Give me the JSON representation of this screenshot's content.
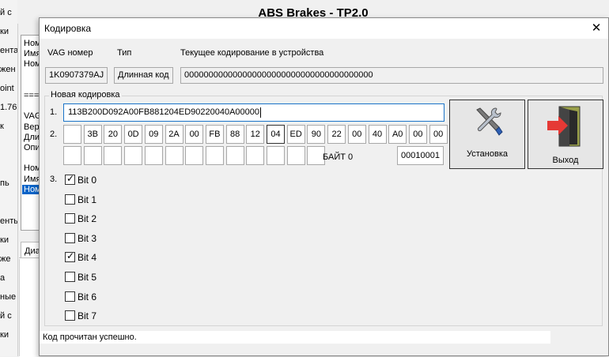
{
  "background_app": {
    "window_title": "ABS Brakes -  TP2.0",
    "left_labels": [
      "й с",
      "ки",
      "ента",
      "жен",
      "oint",
      "1.76",
      "к",
      "",
      "",
      "пь",
      "",
      "енты",
      "ки",
      "же",
      "а",
      "ные",
      "й с",
      "ки"
    ],
    "list_items": [
      "Ном",
      "Имя",
      "Ном",
      "",
      "",
      "===",
      "",
      "VAG",
      "Вер",
      "Дли",
      "Опи",
      "",
      "Ном",
      "Имя",
      "Ном"
    ],
    "tab_label": "Диа"
  },
  "dialog": {
    "title": "Кодировка",
    "close_label": "✕",
    "vag_label": "VAG номер",
    "vag_value": "1K0907379AJ",
    "type_label": "Тип",
    "type_value": "Длинная код",
    "current_label": "Текущее кодирование в устройства",
    "current_value": "000000000000000000000000000000000000000",
    "new_group_title": "Новая кодировка",
    "step1": "1.",
    "step2": "2.",
    "step3": "3.",
    "new_coding_value": "113B200D092A00FB881204ED90220040A00000",
    "bytes": [
      "",
      "3B",
      "20",
      "0D",
      "09",
      "2A",
      "00",
      "FB",
      "88",
      "12",
      "04",
      "ED",
      "90",
      "22",
      "00",
      "40",
      "A0",
      "00",
      "00"
    ],
    "bytes_row2": [
      "",
      "",
      "",
      "",
      "",
      "",
      "",
      "",
      "",
      "",
      "",
      "",
      ""
    ],
    "active_byte_index": 10,
    "byte_label": "БАЙТ 0",
    "byte_binary": "00010001",
    "install_button": "Установка",
    "exit_button": "Выход",
    "bits": [
      {
        "label": "Bit 0",
        "checked": true
      },
      {
        "label": "Bit 1",
        "checked": false
      },
      {
        "label": "Bit 2",
        "checked": false
      },
      {
        "label": "Bit 3",
        "checked": false
      },
      {
        "label": "Bit 4",
        "checked": true
      },
      {
        "label": "Bit 5",
        "checked": false
      },
      {
        "label": "Bit 6",
        "checked": false
      },
      {
        "label": "Bit 7",
        "checked": false
      }
    ],
    "status_text": "Код прочитан успешно."
  },
  "icons": {
    "install": "tools-icon",
    "exit": "exit-door-icon"
  }
}
